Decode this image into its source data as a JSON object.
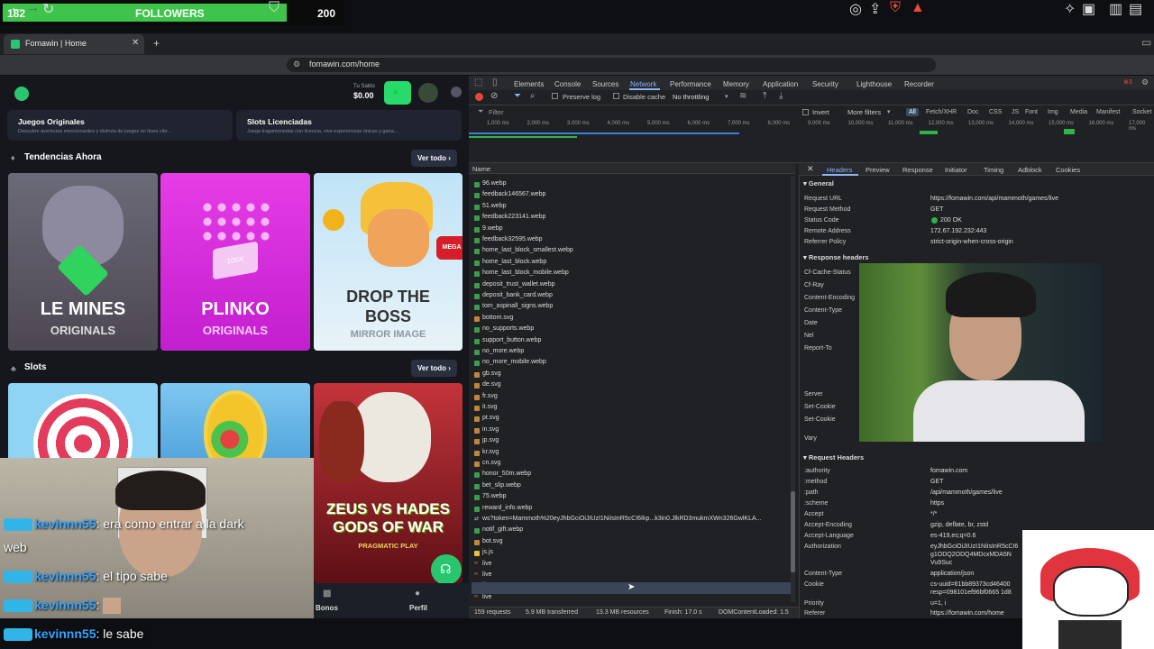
{
  "followers": {
    "current": "182",
    "label": "FOLLOWERS",
    "goal": "200",
    "progress": 0.91
  },
  "browser": {
    "tab_title": "Fomawin | Home",
    "new_tab": "+",
    "url": "fomawin.com/home"
  },
  "site": {
    "balance_label": "Tu Saldo",
    "balance": "$0.00",
    "categories": [
      {
        "title": "Juegos Originales",
        "desc": "Descubre aventuras emocionantes y disfruta de juegos en línea vibr..."
      },
      {
        "title": "Slots Licenciadas",
        "desc": "Juega tragamonedas con licencia, vive experiencias únicas y gana..."
      }
    ],
    "trending_title": "Tendencias Ahora",
    "see_all": "Ver todo",
    "trending": [
      {
        "name": "LE MINES",
        "sub": "ORIGINALS"
      },
      {
        "name": "PLINKO",
        "sub": "ORIGINALS",
        "mark": "100X"
      },
      {
        "name": "DROP THE BOSS",
        "sub": "MIRROR IMAGE",
        "mark": "MEGA"
      }
    ],
    "slots_title": "Slots",
    "slots": [
      {
        "name": "",
        "sub": ""
      },
      {
        "name": "",
        "sub": ""
      },
      {
        "name": "ZEUS VS HADES GODS OF WAR",
        "sub": "PRAGMATIC PLAY"
      }
    ],
    "bottom_nav": [
      {
        "label": "Bonos"
      },
      {
        "label": "Perfil"
      }
    ]
  },
  "devtools": {
    "tabs": [
      "Elements",
      "Console",
      "Sources",
      "Network",
      "Performance",
      "Memory",
      "Application",
      "Security",
      "Lighthouse",
      "Recorder"
    ],
    "active_tab": "Network",
    "preserve_log": "Preserve log",
    "disable_cache": "Disable cache",
    "throttling": "No throttling",
    "filter_placeholder": "Filter",
    "invert": "Invert",
    "more_filters": "More filters",
    "type_filters": [
      "All",
      "Fetch/XHR",
      "Doc",
      "CSS",
      "JS",
      "Font",
      "Img",
      "Media",
      "Manifest",
      "Socket"
    ],
    "timeline_ticks": [
      "1,000 ms",
      "2,000 ms",
      "3,000 ms",
      "4,000 ms",
      "5,000 ms",
      "6,000 ms",
      "7,000 ms",
      "8,000 ms",
      "9,000 ms",
      "10,000 ms",
      "11,000 ms",
      "12,000 ms",
      "13,000 ms",
      "14,000 ms",
      "15,000 ms",
      "16,000 ms",
      "17,000 ms"
    ],
    "name_header": "Name",
    "requests": [
      "96.webp",
      "feedback146567.webp",
      "51.webp",
      "feedback223141.webp",
      "9.webp",
      "feedback32595.webp",
      "home_last_block_smallest.webp",
      "home_last_block.webp",
      "home_last_block_mobile.webp",
      "deposit_trust_wallet.webp",
      "deposit_bank_card.webp",
      "tom_aspinall_signs.webp",
      "bottom.svg",
      "no_supports.webp",
      "support_button.webp",
      "no_more.webp",
      "no_more_mobile.webp",
      "gb.svg",
      "de.svg",
      "fr.svg",
      "it.svg",
      "pt.svg",
      "in.svg",
      "jp.svg",
      "kr.svg",
      "cn.svg",
      "honor_50m.webp",
      "bet_slip.webp",
      "75.webp",
      "reward_info.webp",
      "ws?token=Mammoth%20eyJhbGciOiJIUzI1NiIsInR5cCI6Ikp...k3in0.JlkRD3mukmXWn326GwlKLA...",
      "notif_gift.webp",
      "bot.svg",
      "js.js",
      "live",
      "live",
      "live",
      "live"
    ],
    "summary": {
      "requests": "159 requests",
      "transferred": "5.9 MB transferred",
      "resources": "13.3 MB resources",
      "finish": "Finish: 17.0 s",
      "dcl": "DOMContentLoaded: 1.5"
    },
    "detail_tabs": [
      "Headers",
      "Preview",
      "Response",
      "Initiator",
      "Timing",
      "Adblock",
      "Cookies"
    ],
    "general_title": "General",
    "general": [
      {
        "k": "Request URL",
        "v": "https://fomawin.com/api/mammoth/games/live"
      },
      {
        "k": "Request Method",
        "v": "GET"
      },
      {
        "k": "Status Code",
        "v": "200 OK"
      },
      {
        "k": "Remote Address",
        "v": "172.67.192.232:443"
      },
      {
        "k": "Referrer Policy",
        "v": "strict-origin-when-cross-origin"
      }
    ],
    "response_title": "Response headers",
    "response_keys": [
      "Cf-Cache-Status",
      "Cf-Ray",
      "Content-Encoding",
      "Content-Type",
      "Date",
      "Nel",
      "Report-To",
      "Server",
      "Set-Cookie",
      "Set-Cookie",
      "Vary"
    ],
    "request_title": "Request Headers",
    "request": [
      {
        "k": ":authority",
        "v": "fomawin.com"
      },
      {
        "k": ":method",
        "v": "GET"
      },
      {
        "k": ":path",
        "v": "/api/mammoth/games/live"
      },
      {
        "k": ":scheme",
        "v": "https"
      },
      {
        "k": "Accept",
        "v": "*/*"
      },
      {
        "k": "Accept-Encoding",
        "v": "gzip, deflate, br, zstd"
      },
      {
        "k": "Accept-Language",
        "v": "es-419,es;q=0.6"
      },
      {
        "k": "Authorization",
        "v": "eyJhbGciOiJIUzI1NiIsInR5cCI6"
      },
      {
        "k": "",
        "v": "g1ODQ2ODQ4MDcxMDA5N"
      },
      {
        "k": "",
        "v": "Vu9Suc"
      },
      {
        "k": "Content-Type",
        "v": "application/json"
      },
      {
        "k": "Cookie",
        "v": "cs-uuid=61bb89373cd46400"
      },
      {
        "k": "",
        "v": "resp=098101ef96bf0665 1d8"
      },
      {
        "k": "Priority",
        "v": "u=1, i"
      },
      {
        "k": "Referer",
        "v": "https://fomawin.com/home"
      }
    ]
  },
  "chat": [
    {
      "user": "kevinnn55",
      "msg": ": era como entrar a la dark"
    },
    {
      "user": "",
      "msg": "web"
    },
    {
      "user": "kevinnn55",
      "msg": ": el tipo sabe"
    },
    {
      "user": "kevinnn55",
      "msg": ":"
    },
    {
      "user": "kevinnn55",
      "msg": ": le sabe"
    }
  ]
}
